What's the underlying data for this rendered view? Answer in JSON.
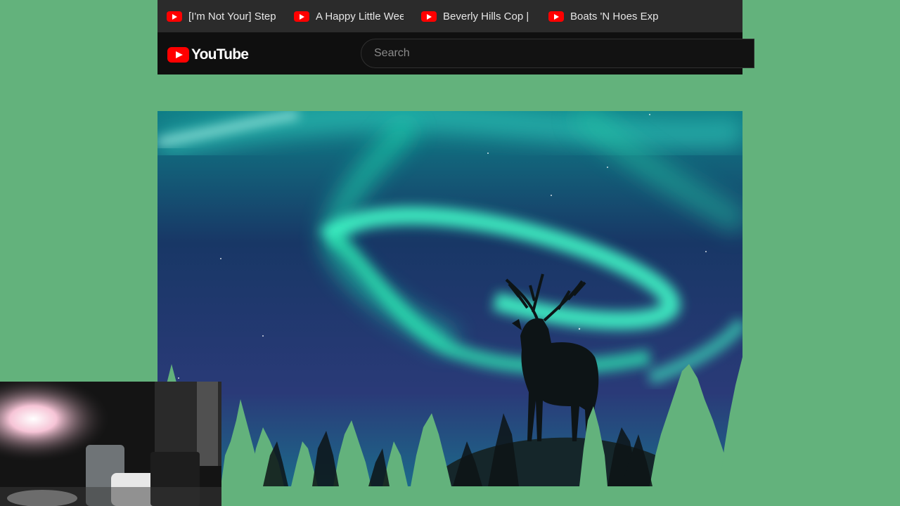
{
  "bookmarks": [
    {
      "label": "[I'm Not Your] Step..."
    },
    {
      "label": "A Happy Little Week..."
    },
    {
      "label": "Beverly Hills Cop | F..."
    },
    {
      "label": "Boats 'N Hoes Expli..."
    }
  ],
  "masthead": {
    "logo_text": "YouTube",
    "search_placeholder": "Search"
  },
  "colors": {
    "page_background": "#63b27c",
    "bookmark_bar": "#2b2b2b",
    "masthead": "#0f0f0f",
    "youtube_red": "#ff0000",
    "aurora_green": "#2ff5b8",
    "night_sky": "#1b2a55"
  },
  "icons": {
    "bookmark_favicon": "youtube-play-icon",
    "logo": "youtube-logo-icon"
  }
}
